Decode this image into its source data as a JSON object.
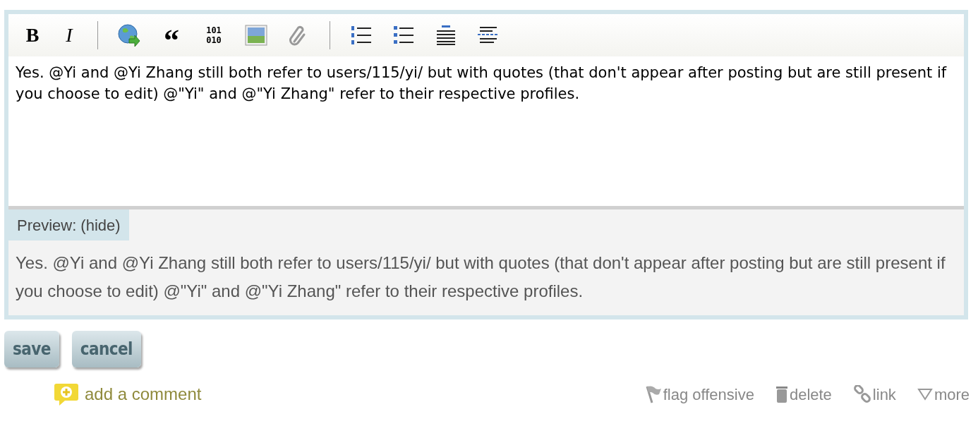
{
  "toolbar": [
    {
      "kind": "bold",
      "label": "B"
    },
    {
      "kind": "italic",
      "label": "I"
    },
    {
      "kind": "separator"
    },
    {
      "kind": "hyperlink"
    },
    {
      "kind": "blockquote",
      "label": "“"
    },
    {
      "kind": "code",
      "label": "101 010"
    },
    {
      "kind": "image"
    },
    {
      "kind": "attachment"
    },
    {
      "kind": "separator"
    },
    {
      "kind": "numbered-list"
    },
    {
      "kind": "bulleted-list"
    },
    {
      "kind": "heading"
    },
    {
      "kind": "rule"
    }
  ],
  "editor": {
    "value": "Yes. @Yi and @Yi Zhang still both refer to users/115/yi/ but with quotes (that don't appear after posting but are still present if you choose to edit) @\"Yi\" and @\"Yi Zhang\" refer to their respective profiles."
  },
  "preview": {
    "label": "Preview:",
    "toggle": "(hide)",
    "text": "Yes. @Yi and @Yi Zhang still both refer to users/115/yi/ but with quotes (that don't appear after posting but are still present if you choose to edit) @\"Yi\" and @\"Yi Zhang\" refer to their respective profiles."
  },
  "buttons": [
    "save",
    "cancel"
  ],
  "add_comment": "add a comment",
  "actions": [
    {
      "kind": "flag",
      "label": "flag offensive"
    },
    {
      "kind": "delete",
      "label": "delete"
    },
    {
      "kind": "link",
      "label": "link"
    },
    {
      "kind": "more",
      "label": "more"
    }
  ]
}
